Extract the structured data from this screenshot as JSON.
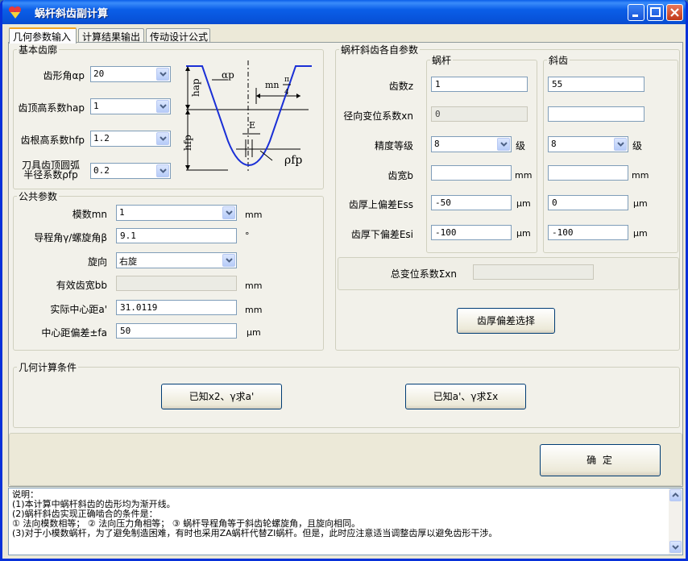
{
  "window": {
    "title": "蜗杆斜齿副计算",
    "icon": "app-logo-icon",
    "min_label": "_",
    "max_label": "□",
    "close_label": "✕"
  },
  "tabs": [
    "几何参数输入",
    "计算结果输出",
    "传动设计公式"
  ],
  "basic_profile": {
    "title": "基本齿廓",
    "pressure_angle": {
      "label": "齿形角αp",
      "value": "20"
    },
    "addendum_coef": {
      "label": "齿顶高系数hap",
      "value": "1"
    },
    "dedendum_coef": {
      "label": "齿根高系数hfp",
      "value": "1.2"
    },
    "tip_radius_coef": {
      "label_line1": "刀具齿顶圆弧",
      "label_line2": "半径系数ρfp",
      "value": "0.2"
    }
  },
  "diagram": {
    "hap": "hap",
    "hfp": "hfp",
    "alpha": "αp",
    "mn": "mn",
    "pi": "π",
    "four": "4",
    "e": "E",
    "rho": "ρfp"
  },
  "common": {
    "title": "公共参数",
    "module": {
      "label": "模数mn",
      "value": "1",
      "unit": "mm"
    },
    "lead_angle": {
      "label": "导程角γ/螺旋角β",
      "value": "9.1",
      "unit": "°"
    },
    "direction": {
      "label": "旋向",
      "value": "右旋"
    },
    "eff_width": {
      "label": "有效齿宽bb",
      "value": "",
      "unit": "mm"
    },
    "center_distance": {
      "label": "实际中心距a'",
      "value": "31.0119",
      "unit": "mm"
    },
    "center_dev": {
      "label": "中心距偏差±fa",
      "value": "50",
      "unit": "μm"
    }
  },
  "gear_params": {
    "title": "蜗杆斜齿各自参数",
    "worm_title": "蜗杆",
    "gear_title": "斜齿",
    "rows": {
      "teeth": "齿数z",
      "shift": "径向变位系数xn",
      "grade": "精度等级",
      "width": "齿宽b",
      "upper_dev": "齿厚上偏差Ess",
      "lower_dev": "齿厚下偏差Esi"
    },
    "worm": {
      "teeth": "1",
      "shift": "0",
      "grade": "8",
      "width": "",
      "upper_dev": "-50",
      "lower_dev": "-100"
    },
    "gear": {
      "teeth": "55",
      "shift": "",
      "grade": "8",
      "width": "",
      "upper_dev": "0",
      "lower_dev": "-100"
    },
    "grade_unit": "级",
    "mm_unit": "mm",
    "um_unit": "μm",
    "total_shift_label": "总变位系数Σxn",
    "total_shift_value": "",
    "thickness_button": "齿厚偏差选择"
  },
  "conditions": {
    "title": "几何计算条件",
    "btn1": "已知x2、γ求a'",
    "btn2": "已知a'、γ求Σx"
  },
  "ok_button": "确 定",
  "notes": [
    "说明：",
    "    (1)本计算中蜗杆斜齿的齿形均为渐开线。",
    "    (2)蜗杆斜齿实现正确啮合的条件是：",
    "       ① 法向模数相等； ② 法向压力角相等； ③ 蜗杆导程角等于斜齿轮螺旋角，且旋向相同。",
    "    (3)对于小模数蜗杆，为了避免制造困难，有时也采用ZA蜗杆代替ZI蜗杆。但是，此时应注意适当调整齿厚以避免齿形干涉。"
  ]
}
